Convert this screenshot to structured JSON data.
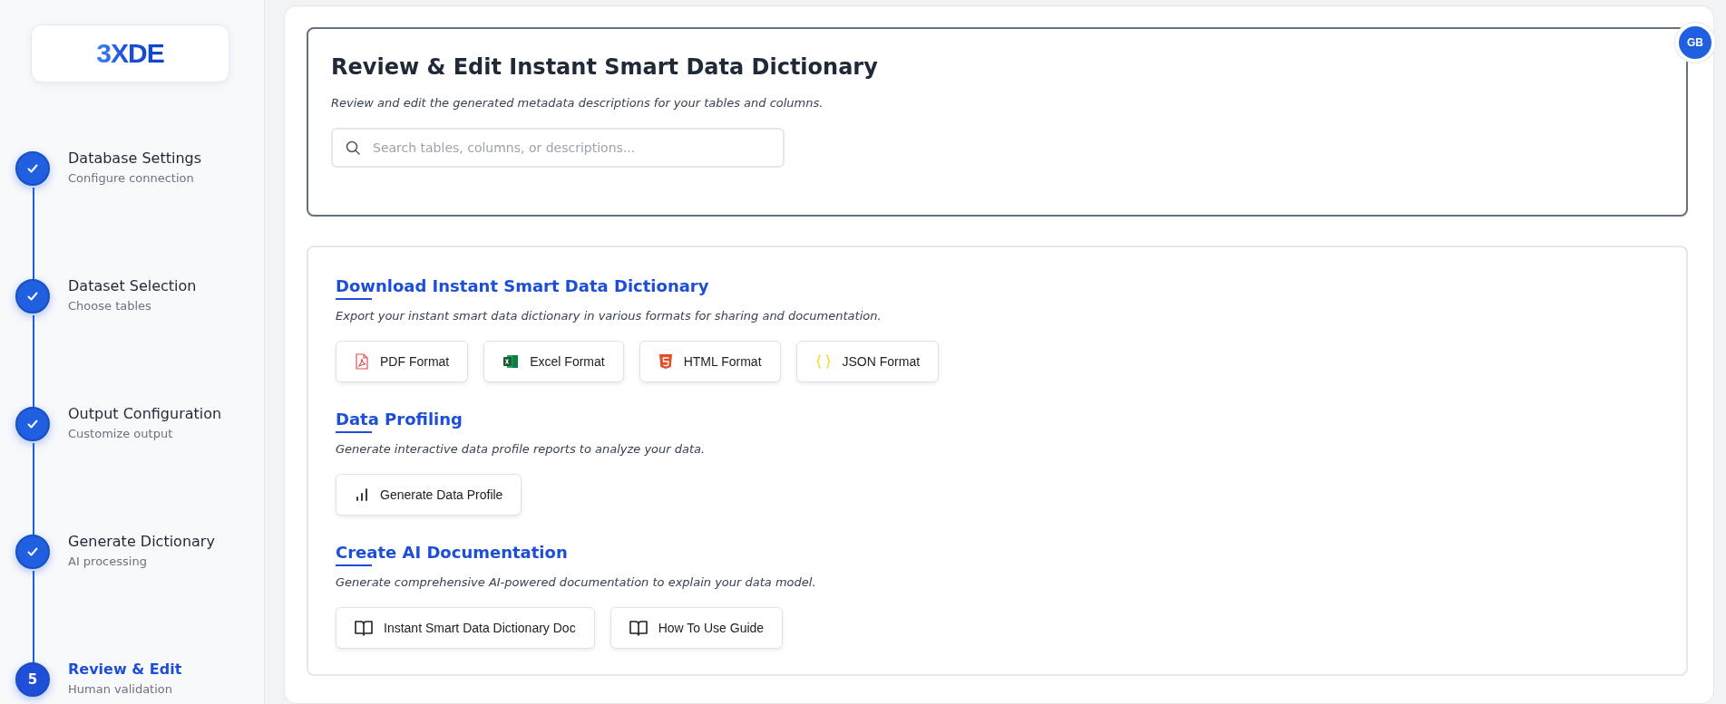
{
  "logo": {
    "text": "3XDE"
  },
  "steps": [
    {
      "title": "Database Settings",
      "subtitle": "Configure connection",
      "completed": true,
      "selected": false
    },
    {
      "title": "Dataset Selection",
      "subtitle": "Choose tables",
      "completed": true,
      "selected": false
    },
    {
      "title": "Output Configuration",
      "subtitle": "Customize output",
      "completed": true,
      "selected": false
    },
    {
      "title": "Generate Dictionary",
      "subtitle": "AI processing",
      "completed": true,
      "selected": false
    },
    {
      "title": "Review & Edit",
      "subtitle": "Human validation",
      "completed": false,
      "selected": true,
      "number": "5"
    }
  ],
  "avatar": {
    "initials": "GB"
  },
  "header": {
    "title": "Review & Edit Instant Smart Data Dictionary",
    "description": "Review and edit the generated metadata descriptions for your tables and columns.",
    "search": {
      "placeholder": "Search tables, columns, or descriptions..."
    }
  },
  "sections": [
    {
      "title": "Download Instant Smart Data Dictionary",
      "description": "Export your instant smart data dictionary in various formats for sharing and documentation.",
      "buttons": [
        {
          "label": "PDF Format",
          "kind": "pdf"
        },
        {
          "label": "Excel Format",
          "kind": "excel"
        },
        {
          "label": "HTML Format",
          "kind": "html"
        },
        {
          "label": "JSON Format",
          "kind": "json"
        }
      ]
    },
    {
      "title": "Data Profiling",
      "description": "Generate interactive data profile reports to analyze your data.",
      "buttons": [
        {
          "label": "Generate Data Profile",
          "kind": "profile"
        }
      ]
    },
    {
      "title": "Create AI Documentation",
      "description": "Generate comprehensive AI-powered documentation to explain your data model.",
      "buttons": [
        {
          "label": "Instant Smart Data Dictionary Doc",
          "kind": "doc"
        },
        {
          "label": "How To Use Guide",
          "kind": "doc"
        }
      ]
    }
  ]
}
